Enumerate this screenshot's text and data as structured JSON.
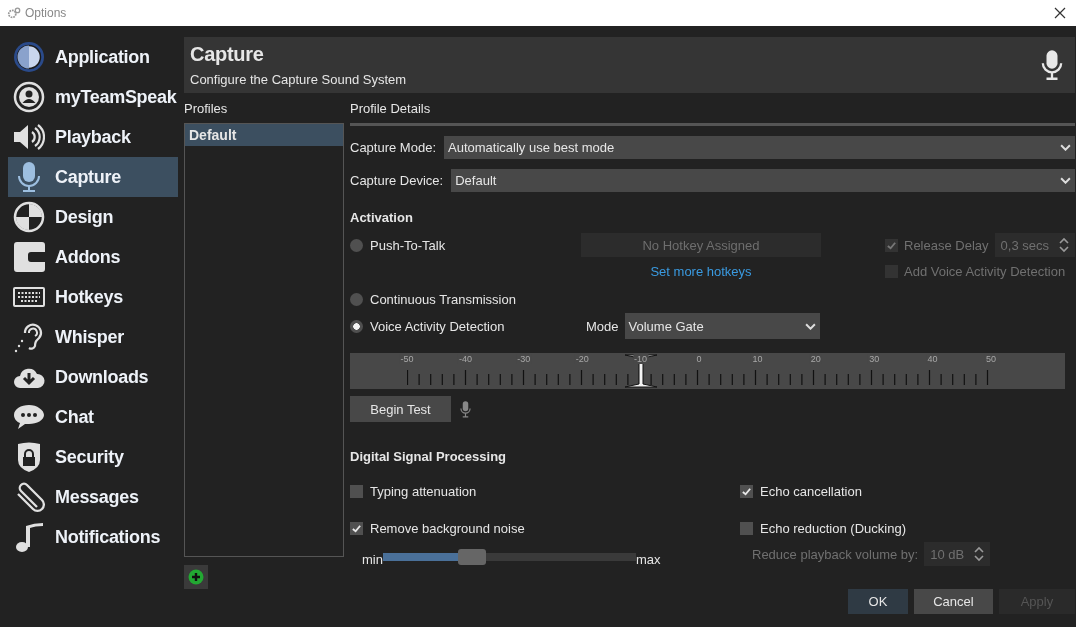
{
  "window": {
    "title": "Options"
  },
  "sidebar": {
    "items": [
      {
        "label": "Application",
        "kind": "application",
        "selected": false
      },
      {
        "label": "myTeamSpeak",
        "kind": "account",
        "selected": false
      },
      {
        "label": "Playback",
        "kind": "speaker",
        "selected": false
      },
      {
        "label": "Capture",
        "kind": "microphone",
        "selected": true
      },
      {
        "label": "Design",
        "kind": "design",
        "selected": false
      },
      {
        "label": "Addons",
        "kind": "addons",
        "selected": false
      },
      {
        "label": "Hotkeys",
        "kind": "keyboard",
        "selected": false
      },
      {
        "label": "Whisper",
        "kind": "ear",
        "selected": false
      },
      {
        "label": "Downloads",
        "kind": "download",
        "selected": false
      },
      {
        "label": "Chat",
        "kind": "chat",
        "selected": false
      },
      {
        "label": "Security",
        "kind": "lock",
        "selected": false
      },
      {
        "label": "Messages",
        "kind": "paperclip",
        "selected": false
      },
      {
        "label": "Notifications",
        "kind": "note",
        "selected": false
      }
    ]
  },
  "header": {
    "title": "Capture",
    "subtitle": "Configure the Capture Sound System"
  },
  "profiles": {
    "heading": "Profiles",
    "items": [
      {
        "label": "Default",
        "selected": true
      }
    ]
  },
  "details": {
    "heading": "Profile Details",
    "fields": [
      {
        "label": "Capture Mode:",
        "value": "Automatically use best mode"
      },
      {
        "label": "Capture Device:",
        "value": "Default"
      }
    ]
  },
  "activation": {
    "heading": "Activation",
    "modes": [
      {
        "label": "Push-To-Talk",
        "selected": false
      },
      {
        "label": "Continuous Transmission",
        "selected": false
      },
      {
        "label": "Voice Activity Detection",
        "selected": true
      }
    ],
    "hotkey_button": "No Hotkey Assigned",
    "more_hotkeys_link": "Set more hotkeys",
    "release_delay": {
      "label": "Release Delay",
      "checked": true,
      "disabled": true,
      "value": "0,3 secs"
    },
    "add_vad": {
      "label": "Add Voice Activity Detection",
      "checked": false,
      "disabled": true
    },
    "mode": {
      "label": "Mode",
      "value": "Volume Gate"
    }
  },
  "gate_meter": {
    "ticks": [
      "-50",
      "-40",
      "-30",
      "-20",
      "-10",
      "0",
      "10",
      "20",
      "30",
      "40",
      "50"
    ],
    "level": 0.4
  },
  "begin_test": "Begin Test",
  "dsp": {
    "heading": "Digital Signal Processing",
    "options": [
      {
        "label": "Typing attenuation",
        "checked": false
      },
      {
        "label": "Echo cancellation",
        "checked": true
      },
      {
        "label": "Remove background noise",
        "checked": true
      },
      {
        "label": "Echo reduction (Ducking)",
        "checked": false
      }
    ],
    "noise_slider": {
      "min_label": "min",
      "max_label": "max",
      "level": 0.35
    },
    "reduce_volume": {
      "label": "Reduce playback volume by:",
      "value": "10 dB",
      "disabled": true
    }
  },
  "buttons": [
    {
      "label": "OK",
      "kind": "default"
    },
    {
      "label": "Cancel",
      "kind": "normal"
    },
    {
      "label": "Apply",
      "kind": "disabled"
    }
  ]
}
